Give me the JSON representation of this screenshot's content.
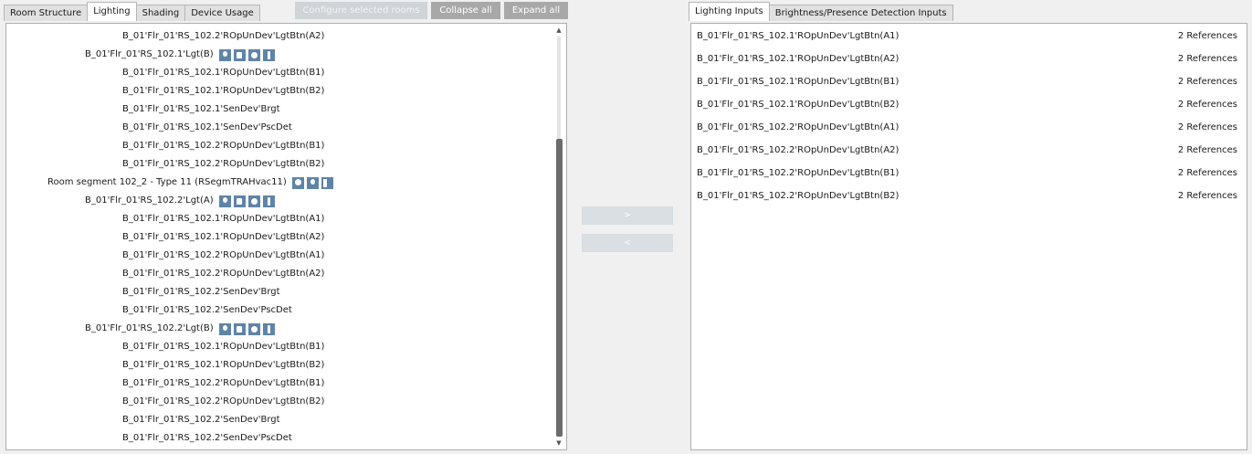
{
  "left_tabs": [
    "Room Structure",
    "Lighting",
    "Shading",
    "Device Usage"
  ],
  "toolbar": {
    "configure": "Configure selected rooms",
    "collapse": "Collapse all",
    "expand": "Expand all"
  },
  "tree": [
    {
      "text": "B_01'Flr_01'RS_102.2'ROpUnDev'LgtBtn(A2)",
      "indent": 133,
      "icons": []
    },
    {
      "text": "B_01'Flr_01'RS_102.1'Lgt(B)",
      "indent": 92,
      "icons": [
        "bulb-icon",
        "hand-icon",
        "sun-icon",
        "walk-icon"
      ]
    },
    {
      "text": "B_01'Flr_01'RS_102.1'ROpUnDev'LgtBtn(B1)",
      "indent": 133,
      "icons": []
    },
    {
      "text": "B_01'Flr_01'RS_102.1'ROpUnDev'LgtBtn(B2)",
      "indent": 133,
      "icons": []
    },
    {
      "text": "B_01'Flr_01'RS_102.1'SenDev'Brgt",
      "indent": 133,
      "icons": []
    },
    {
      "text": "B_01'Flr_01'RS_102.1'SenDev'PscDet",
      "indent": 133,
      "icons": []
    },
    {
      "text": "B_01'Flr_01'RS_102.2'ROpUnDev'LgtBtn(B1)",
      "indent": 133,
      "icons": []
    },
    {
      "text": "B_01'Flr_01'RS_102.2'ROpUnDev'LgtBtn(B2)",
      "indent": 133,
      "icons": []
    },
    {
      "text": "Room segment 102_2 - Type 11 (RSegmTRAHvac11)",
      "indent": 51,
      "icons": [
        "person-icon",
        "bulb-icon",
        "panel-icon"
      ]
    },
    {
      "text": "B_01'Flr_01'RS_102.2'Lgt(A)",
      "indent": 92,
      "icons": [
        "bulb-icon",
        "hand-icon",
        "sun-icon",
        "walk-icon"
      ]
    },
    {
      "text": "B_01'Flr_01'RS_102.1'ROpUnDev'LgtBtn(A1)",
      "indent": 133,
      "icons": []
    },
    {
      "text": "B_01'Flr_01'RS_102.1'ROpUnDev'LgtBtn(A2)",
      "indent": 133,
      "icons": []
    },
    {
      "text": "B_01'Flr_01'RS_102.2'ROpUnDev'LgtBtn(A1)",
      "indent": 133,
      "icons": []
    },
    {
      "text": "B_01'Flr_01'RS_102.2'ROpUnDev'LgtBtn(A2)",
      "indent": 133,
      "icons": []
    },
    {
      "text": "B_01'Flr_01'RS_102.2'SenDev'Brgt",
      "indent": 133,
      "icons": []
    },
    {
      "text": "B_01'Flr_01'RS_102.2'SenDev'PscDet",
      "indent": 133,
      "icons": []
    },
    {
      "text": "B_01'Flr_01'RS_102.2'Lgt(B)",
      "indent": 92,
      "icons": [
        "bulb-icon",
        "hand-icon",
        "sun-icon",
        "walk-icon"
      ]
    },
    {
      "text": "B_01'Flr_01'RS_102.1'ROpUnDev'LgtBtn(B1)",
      "indent": 133,
      "icons": []
    },
    {
      "text": "B_01'Flr_01'RS_102.1'ROpUnDev'LgtBtn(B2)",
      "indent": 133,
      "icons": []
    },
    {
      "text": "B_01'Flr_01'RS_102.2'ROpUnDev'LgtBtn(B1)",
      "indent": 133,
      "icons": []
    },
    {
      "text": "B_01'Flr_01'RS_102.2'ROpUnDev'LgtBtn(B2)",
      "indent": 133,
      "icons": []
    },
    {
      "text": "B_01'Flr_01'RS_102.2'SenDev'Brgt",
      "indent": 133,
      "icons": []
    },
    {
      "text": "B_01'Flr_01'RS_102.2'SenDev'PscDet",
      "indent": 133,
      "icons": []
    }
  ],
  "middle": {
    "add": ">",
    "remove": "<"
  },
  "right_tabs": [
    "Lighting Inputs",
    "Brightness/Presence Detection Inputs"
  ],
  "inputs": [
    {
      "name": "B_01'Flr_01'RS_102.1'ROpUnDev'LgtBtn(A1)",
      "refs": "2  References"
    },
    {
      "name": "B_01'Flr_01'RS_102.1'ROpUnDev'LgtBtn(A2)",
      "refs": "2  References"
    },
    {
      "name": "B_01'Flr_01'RS_102.1'ROpUnDev'LgtBtn(B1)",
      "refs": "2  References"
    },
    {
      "name": "B_01'Flr_01'RS_102.1'ROpUnDev'LgtBtn(B2)",
      "refs": "2  References"
    },
    {
      "name": "B_01'Flr_01'RS_102.2'ROpUnDev'LgtBtn(A1)",
      "refs": "2  References"
    },
    {
      "name": "B_01'Flr_01'RS_102.2'ROpUnDev'LgtBtn(A2)",
      "refs": "2  References"
    },
    {
      "name": "B_01'Flr_01'RS_102.2'ROpUnDev'LgtBtn(B1)",
      "refs": "2  References"
    },
    {
      "name": "B_01'Flr_01'RS_102.2'ROpUnDev'LgtBtn(B2)",
      "refs": "2  References"
    }
  ]
}
